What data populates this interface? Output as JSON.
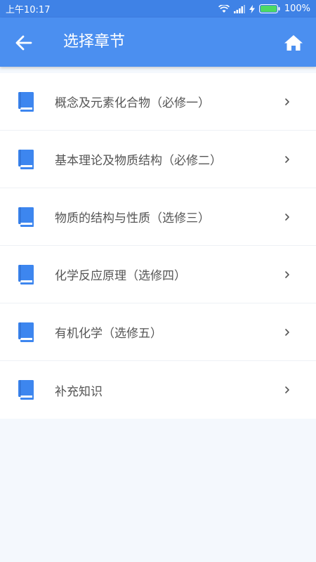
{
  "status_bar": {
    "time": "上午10:17",
    "battery": "100%"
  },
  "header": {
    "title": "选择章节",
    "back_icon": "arrow-left-icon",
    "home_icon": "home-icon"
  },
  "colors": {
    "status_bar": "#3f82e6",
    "app_bar": "#4b8ff0",
    "icon_blue": "#3d86ef",
    "background": "#f4f8fd",
    "text": "#555555"
  },
  "chapters": [
    {
      "label": "概念及元素化合物（必修一）",
      "icon": "book-icon"
    },
    {
      "label": "基本理论及物质结构（必修二）",
      "icon": "book-icon"
    },
    {
      "label": "物质的结构与性质（选修三）",
      "icon": "book-icon"
    },
    {
      "label": "化学反应原理（选修四）",
      "icon": "book-icon"
    },
    {
      "label": "有机化学（选修五）",
      "icon": "book-icon"
    },
    {
      "label": "补充知识",
      "icon": "book-icon"
    }
  ]
}
